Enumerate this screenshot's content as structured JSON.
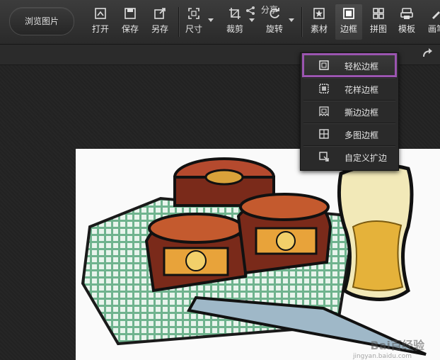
{
  "toolbar": {
    "browse_label": "浏览图片",
    "items": [
      {
        "label": "打开",
        "icon": "open-icon"
      },
      {
        "label": "保存",
        "icon": "save-icon"
      },
      {
        "label": "另存",
        "icon": "save-as-icon"
      },
      {
        "label": "尺寸",
        "icon": "resize-icon"
      },
      {
        "label": "裁剪",
        "icon": "crop-icon"
      },
      {
        "label": "旋转",
        "icon": "rotate-icon"
      },
      {
        "label": "素材",
        "icon": "sticker-icon"
      },
      {
        "label": "边框",
        "icon": "frame-icon"
      },
      {
        "label": "拼图",
        "icon": "collage-icon"
      },
      {
        "label": "模板",
        "icon": "template-icon"
      },
      {
        "label": "画笔",
        "icon": "brush-icon"
      }
    ],
    "active": "边框"
  },
  "subbar": {
    "share_label": "分享"
  },
  "frame_menu": {
    "items": [
      {
        "label": "轻松边框",
        "icon": "simple-frame-icon",
        "selected": true
      },
      {
        "label": "花样边框",
        "icon": "pattern-frame-icon",
        "selected": false
      },
      {
        "label": "撕边边框",
        "icon": "torn-edge-frame-icon",
        "selected": false
      },
      {
        "label": "多图边框",
        "icon": "multi-image-frame-icon",
        "selected": false
      },
      {
        "label": "自定义扩边",
        "icon": "custom-extend-icon",
        "selected": false
      }
    ],
    "highlight_color": "#9b55b0"
  },
  "watermark": {
    "text": "Bai百经验",
    "sub": "jingyan.baidu.com"
  }
}
